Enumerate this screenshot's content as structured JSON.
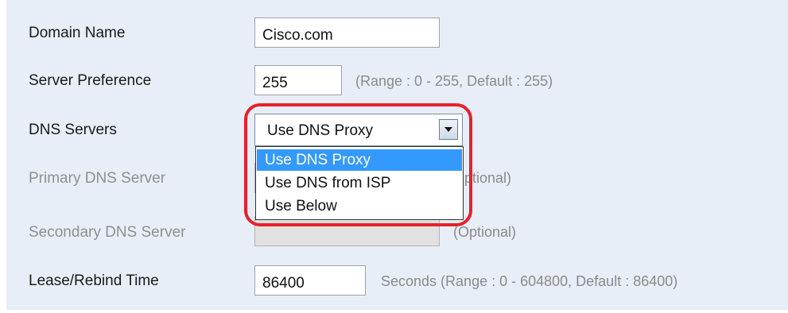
{
  "form": {
    "domain_name": {
      "label": "Domain Name",
      "value": "Cisco.com"
    },
    "server_preference": {
      "label": "Server Preference",
      "value": "255",
      "hint": "(Range : 0 - 255, Default : 255)"
    },
    "dns_servers": {
      "label": "DNS Servers",
      "selected": "Use DNS Proxy",
      "options": [
        "Use DNS Proxy",
        "Use DNS from ISP",
        "Use Below"
      ]
    },
    "primary_dns": {
      "label": "Primary DNS Server",
      "hint": "(Optional)",
      "visible_hint": "ptional)"
    },
    "secondary_dns": {
      "label": "Secondary DNS Server",
      "hint": "(Optional)"
    },
    "lease_rebind": {
      "label": "Lease/Rebind Time",
      "value": "86400",
      "hint": "Seconds (Range : 0 - 604800, Default : 86400)"
    }
  },
  "colors": {
    "panel_bg": "#e8eef7",
    "highlight_ring": "#e8202a",
    "option_selected": "#3399ff"
  },
  "icons": {
    "dropdown_arrow": "chevron-down-icon"
  }
}
